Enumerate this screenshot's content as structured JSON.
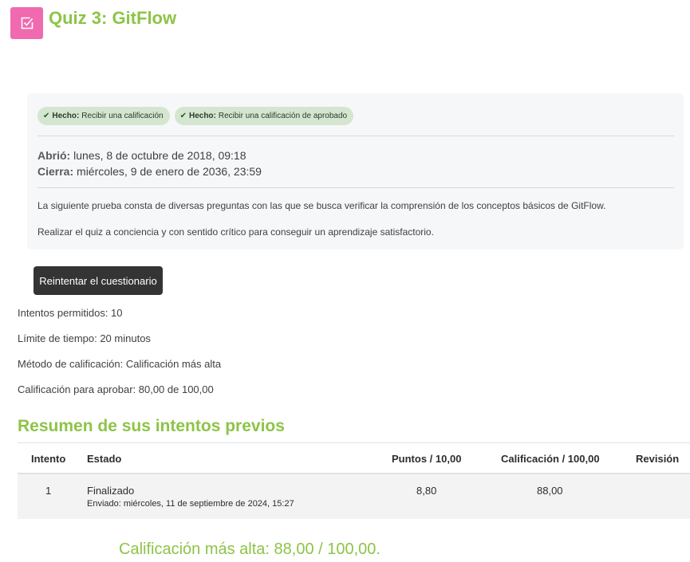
{
  "header": {
    "title": "Quiz 3: GitFlow",
    "icon": "quiz-checkbox-icon",
    "icon_color": "#f06ab0",
    "title_color": "#8dc447"
  },
  "completion": [
    {
      "label": "Hecho:",
      "text": "Recibir una calificación"
    },
    {
      "label": "Hecho:",
      "text": "Recibir una calificación de aprobado"
    }
  ],
  "dates": {
    "opened_label": "Abrió:",
    "opened_value": "lunes, 8 de octubre de 2018, 09:18",
    "closes_label": "Cierra:",
    "closes_value": "miércoles, 9 de enero de 2036, 23:59"
  },
  "description": [
    "La siguiente prueba consta de diversas preguntas con las que se busca verificar la comprensión de los conceptos básicos de GitFlow.",
    "Realizar el quiz a conciencia y con sentido crítico para conseguir un aprendizaje satisfactorio."
  ],
  "retry_button": "Reintentar el cuestionario",
  "quiz_info": [
    "Intentos permitidos: 10",
    "Límite de tiempo: 20 minutos",
    "Método de calificación: Calificación más alta",
    "Calificación para aprobar: 80,00 de 100,00"
  ],
  "summary": {
    "title": "Resumen de sus intentos previos",
    "columns": [
      "Intento",
      "Estado",
      "Puntos / 10,00",
      "Calificación / 100,00",
      "Revisión"
    ],
    "rows": [
      {
        "attempt": "1",
        "state": "Finalizado",
        "submitted": "Enviado: miércoles, 11 de septiembre de 2024, 15:27",
        "points": "8,80",
        "grade": "88,00",
        "review": ""
      }
    ]
  },
  "best_grade": "Calificación más alta: 88,00 / 100,00."
}
